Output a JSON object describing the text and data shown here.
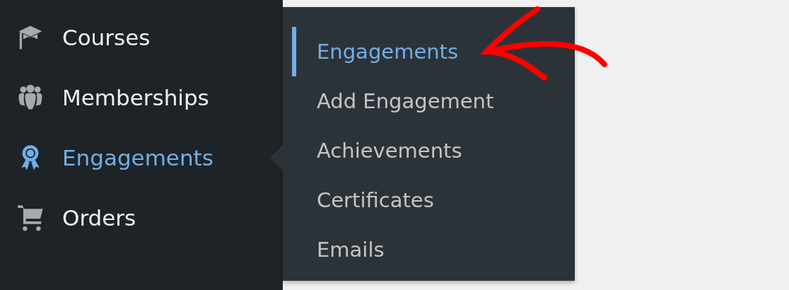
{
  "sidebar": {
    "items": [
      {
        "label": "Courses",
        "kind": "cap",
        "selected": false
      },
      {
        "label": "Memberships",
        "kind": "people",
        "selected": false
      },
      {
        "label": "Engagements",
        "kind": "award",
        "selected": true
      },
      {
        "label": "Orders",
        "kind": "cart",
        "selected": false
      }
    ]
  },
  "submenu": {
    "items": [
      {
        "label": "Engagements",
        "selected": true
      },
      {
        "label": "Add Engagement",
        "selected": false
      },
      {
        "label": "Achievements",
        "selected": false
      },
      {
        "label": "Certificates",
        "selected": false
      },
      {
        "label": "Emails",
        "selected": false
      }
    ]
  }
}
